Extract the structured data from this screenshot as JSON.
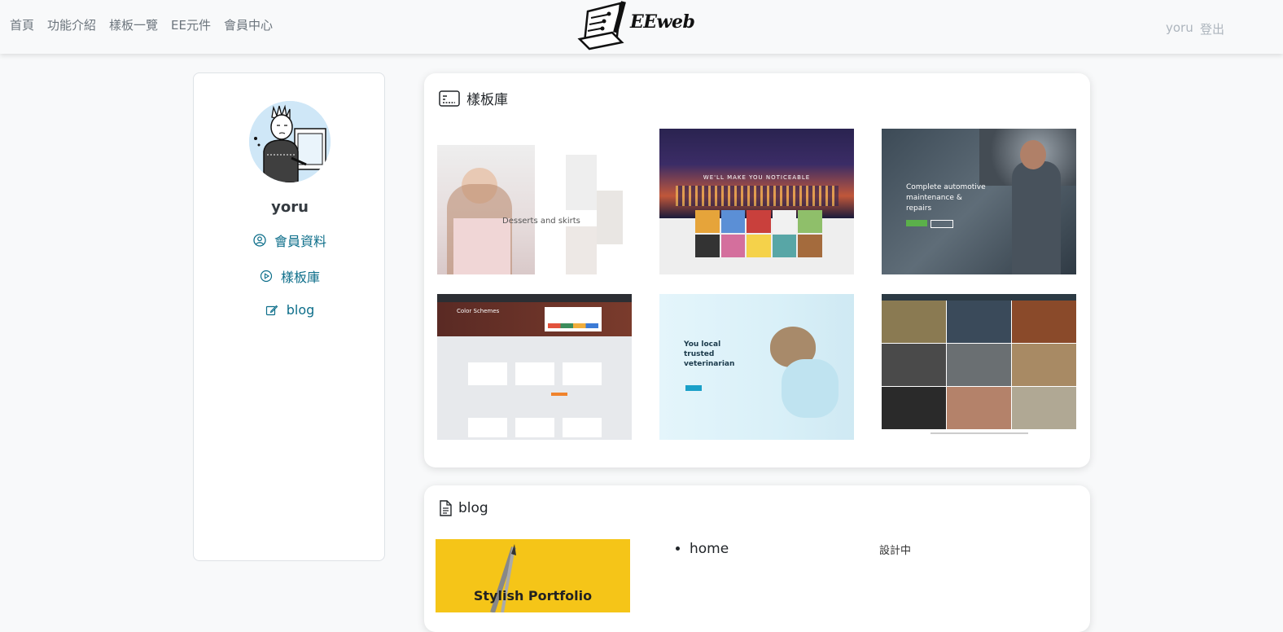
{
  "nav": {
    "links": [
      "首頁",
      "功能介紹",
      "樣板一覽",
      "EE元件",
      "會員中心"
    ],
    "brand": "EEweb",
    "user": "yoru",
    "logout": "登出"
  },
  "sidebar": {
    "username": "yoru",
    "items": [
      {
        "label": "會員資料",
        "icon": "user-circle-icon"
      },
      {
        "label": "樣板庫",
        "icon": "play-circle-icon"
      },
      {
        "label": "blog",
        "icon": "edit-icon"
      }
    ]
  },
  "templates": {
    "title": "樣板庫",
    "items": [
      {
        "caption": "Desserts and skirts",
        "theme": "fashion"
      },
      {
        "caption": "WE'LL MAKE YOU NOTICEABLE",
        "theme": "city-night"
      },
      {
        "caption": "Complete automotive maintenance & repairs",
        "theme": "mechanic"
      },
      {
        "caption": "Color Schemes",
        "theme": "business"
      },
      {
        "caption": "You local trusted veterinarian",
        "theme": "vet-cat"
      },
      {
        "caption": "",
        "theme": "photo-grid"
      }
    ]
  },
  "blog": {
    "title": "blog",
    "thumb_caption": "Stylish Portfolio",
    "list": [
      "home"
    ],
    "status": "設計中"
  },
  "colors": {
    "accent": "#0d6e8a",
    "nav_text": "#6c757d",
    "blog_yellow": "#f5c518"
  }
}
